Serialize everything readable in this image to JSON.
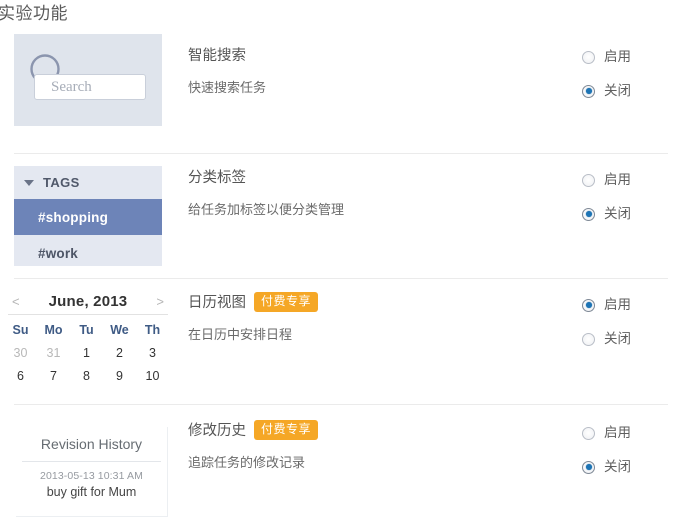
{
  "page": {
    "title": "实验功能"
  },
  "colors": {
    "badge_orange": "#f5a726",
    "radio_selected_blue": "#1d74b5",
    "tag_selected_blue": "#6d84b8",
    "search_panel_bg": "#dfe4ec",
    "tags_panel_bg": "#e4e8f1",
    "separator": "#ebebeb"
  },
  "radio_options": {
    "on_label": "启用",
    "off_label": "关闭"
  },
  "features": [
    {
      "name": "智能搜索",
      "description": "快速搜索任务",
      "badge": "",
      "enabled_label": "启用",
      "disabled_label": "关闭",
      "selected": "关闭",
      "thumbnail": {
        "type": "search-preview",
        "icon": "magnifier-icon",
        "placeholder": "Search"
      }
    },
    {
      "name": "分类标签",
      "description": "给任务加标签以便分类管理",
      "badge": "",
      "enabled_label": "启用",
      "disabled_label": "关闭",
      "selected": "关闭",
      "thumbnail": {
        "type": "tags-preview",
        "header": "TAGS",
        "items": [
          {
            "label": "#shopping",
            "selected": true
          },
          {
            "label": "#work",
            "selected": false
          }
        ]
      }
    },
    {
      "name": "日历视图",
      "description": "在日历中安排日程",
      "badge": "付费专享",
      "enabled_label": "启用",
      "disabled_label": "关闭",
      "selected": "启用",
      "thumbnail": {
        "type": "calendar-preview",
        "month_title": "June, 2013",
        "prev_arrow": "<",
        "next_arrow": ">",
        "day_headers": [
          "Su",
          "Mo",
          "Tu",
          "We",
          "Th"
        ],
        "weeks": [
          [
            {
              "day": "30",
              "muted": true
            },
            {
              "day": "31",
              "muted": true
            },
            {
              "day": "1",
              "muted": false
            },
            {
              "day": "2",
              "muted": false
            },
            {
              "day": "3",
              "muted": false
            }
          ],
          [
            {
              "day": "6",
              "muted": false
            },
            {
              "day": "7",
              "muted": false
            },
            {
              "day": "8",
              "muted": false
            },
            {
              "day": "9",
              "muted": false
            },
            {
              "day": "10",
              "muted": false
            }
          ]
        ]
      }
    },
    {
      "name": "修改历史",
      "description": "追踪任务的修改记录",
      "badge": "付费专享",
      "enabled_label": "启用",
      "disabled_label": "关闭",
      "selected": "关闭",
      "thumbnail": {
        "type": "revision-preview",
        "title": "Revision History",
        "entry_date": "2013-05-13 10:31 AM",
        "entry_text": "buy gift for Mum"
      }
    }
  ]
}
